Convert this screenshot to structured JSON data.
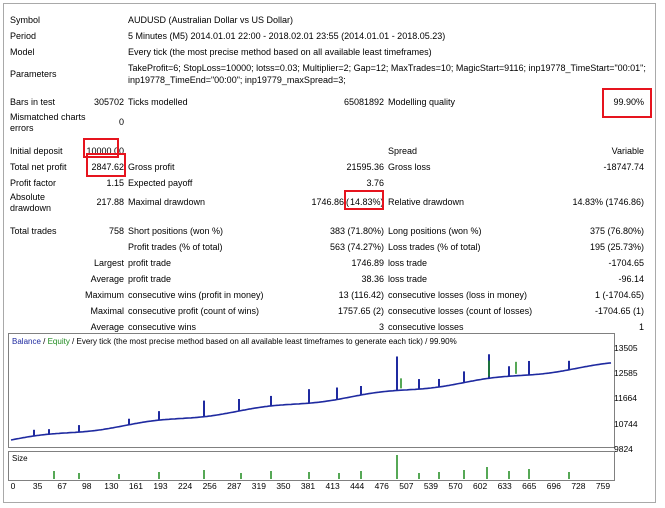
{
  "report": {
    "symbol_label": "Symbol",
    "symbol_value": "AUDUSD (Australian Dollar vs US Dollar)",
    "period_label": "Period",
    "period_value": "5 Minutes (M5) 2014.01.01 22:00 - 2018.02.01 23:55 (2014.01.01 - 2018.05.23)",
    "model_label": "Model",
    "model_value": "Every tick (the most precise method based on all available least timeframes)",
    "parameters_label": "Parameters",
    "parameters_line1": "TakeProfit=6; StopLoss=10000; lotss=0.03; Multiplier=2; Gap=12; MaxTrades=10; MagicStart=9116; inp19778_TimeStart=\"00:01\";",
    "parameters_line2": "inp19778_TimeEnd=\"00:00\"; inp19779_maxSpread=3;",
    "bars_label": "Bars in test",
    "bars_value": "305702",
    "ticks_label": "Ticks modelled",
    "ticks_value": "65081892",
    "quality_label": "Modelling quality",
    "quality_value": "99.90%",
    "mismatch_label_1": "Mismatched charts",
    "mismatch_label_2": "errors",
    "mismatch_value": "0",
    "deposit_label": "Initial deposit",
    "deposit_value": "10000.00",
    "spread_label": "Spread",
    "spread_value": "Variable",
    "netprofit_label": "Total net profit",
    "netprofit_value": "2847.62",
    "grossprofit_label": "Gross profit",
    "grossprofit_value": "21595.36",
    "grossloss_label": "Gross loss",
    "grossloss_value": "-18747.74",
    "pf_label": "Profit factor",
    "pf_value": "1.15",
    "payoff_label": "Expected payoff",
    "payoff_value": "3.76",
    "absdd_label_1": "Absolute",
    "absdd_label_2": "drawdown",
    "absdd_value": "217.88",
    "maxdd_label": "Maximal drawdown",
    "maxdd_value": "1746.86",
    "maxdd_pct": "14.83%)",
    "maxdd_open": "(",
    "reldd_label": "Relative drawdown",
    "reldd_value": "14.83% (1746.86)",
    "trades_label": "Total trades",
    "trades_value": "758",
    "short_label": "Short positions (won %)",
    "short_value": "383 (71.80%)",
    "long_label": "Long positions (won %)",
    "long_value": "375 (76.80%)",
    "ptrades_label": "Profit trades (% of total)",
    "ptrades_value": "563 (74.27%)",
    "ltrades_label": "Loss trades (% of total)",
    "ltrades_value": "195 (25.73%)",
    "largest": "Largest",
    "average": "Average",
    "maximum": "Maximum",
    "maximal": "Maximal",
    "profit_trade": "profit trade",
    "largest_profit": "1746.89",
    "loss_trade": "loss trade",
    "largest_loss": "-1704.65",
    "average_profit": "38.36",
    "average_loss": "-96.14",
    "cwins_label": "consecutive wins (profit in money)",
    "cwins_value": "13 (116.42)",
    "closs_label": "consecutive losses (loss in money)",
    "closs_value": "1 (-1704.65)",
    "cprofit_label": "consecutive profit (count of wins)",
    "cprofit_value": "1757.65 (2)",
    "cclosses_label": "consecutive losses (count of losses)",
    "cclosses_value": "-1704.65 (1)",
    "acwins_label": "consecutive wins",
    "acwins_value": "3",
    "acloss_label": "consecutive losses",
    "acloss_value": "1"
  },
  "chart": {
    "legend_balance": "Balance",
    "legend_sep": " / ",
    "legend_equity": "Equity",
    "legend_rest": " / Every tick (the most precise method based on all available least timeframes to generate each tick) / 99.90%",
    "size_label": "Size",
    "colors": {
      "balance": "#1f2aa0",
      "equity": "#1d8a1d",
      "highlight": "#e6141e"
    },
    "y_ticks": [
      "13505",
      "12585",
      "11664",
      "10744",
      "9824"
    ],
    "x_ticks": [
      "0",
      "35",
      "67",
      "98",
      "130",
      "161",
      "193",
      "224",
      "256",
      "287",
      "319",
      "350",
      "381",
      "413",
      "444",
      "476",
      "507",
      "539",
      "570",
      "602",
      "633",
      "665",
      "696",
      "728",
      "759"
    ]
  }
}
